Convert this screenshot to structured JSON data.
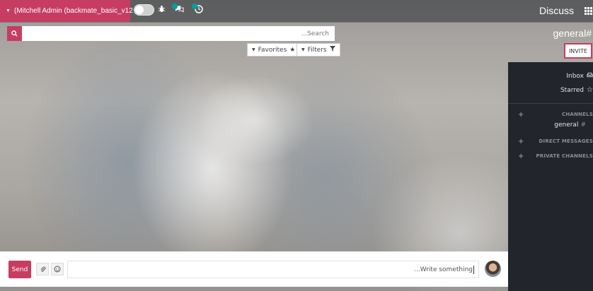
{
  "navbar": {
    "user_label": "(Mitchell Admin (backmate_basic_v12",
    "app_title": "Discuss",
    "icons": [
      "toggle-switch",
      "bug-icon",
      "chat-icon",
      "activity-clock-icon",
      "apps-grid-icon"
    ]
  },
  "control_panel": {
    "search_placeholder": "...Search",
    "favorites_label": "Favorites",
    "filters_label": "Filters",
    "channel_title": "general#",
    "invite_label": "INVITE"
  },
  "sidebar": {
    "inbox_label": "Inbox",
    "starred_label": "Starred",
    "channels_header": "CHANNELS",
    "channels": [
      {
        "name": "general",
        "symbol": "#"
      }
    ],
    "direct_messages_header": "DIRECT MESSAGES",
    "private_channels_header": "PRIVATE CHANNELS"
  },
  "composer": {
    "send_label": "Send",
    "message_placeholder": "...Write something"
  },
  "colors": {
    "accent": "#c63d61",
    "sidebar_bg": "#22252b",
    "badge": "#00a09d"
  }
}
